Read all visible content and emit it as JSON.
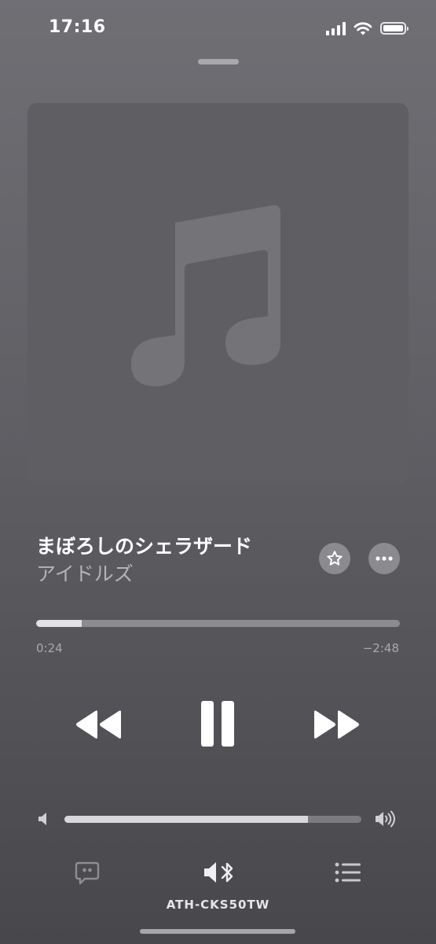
{
  "status_bar": {
    "time": "17:16",
    "icons": [
      "signal-icon",
      "wifi-icon",
      "battery-icon"
    ]
  },
  "artwork": {
    "icon": "music-note-icon",
    "placeholder": true
  },
  "now_playing": {
    "title": "まぼろしのシェラザード",
    "artist": "アイドルズ"
  },
  "actions": {
    "favorite_icon": "star-icon",
    "more_icon": "ellipsis-icon"
  },
  "playback": {
    "elapsed": "0:24",
    "remaining": "−2:48",
    "progress_fraction": 0.125,
    "state": "playing"
  },
  "controls": [
    "rewind-icon",
    "pause-icon",
    "fast-forward-icon"
  ],
  "volume": {
    "level_fraction": 0.82
  },
  "bottom_bar": {
    "lyrics_icon": "lyrics-bubble-icon",
    "airplay_icon": "speaker-bluetooth-icon",
    "queue_icon": "list-icon",
    "device_name": "ATH-CKS50TW"
  },
  "colors": {
    "background_top": "#6f6f74",
    "background_bottom": "#48484c",
    "text_primary": "#ffffff",
    "text_secondary": "#b4b4b8"
  }
}
